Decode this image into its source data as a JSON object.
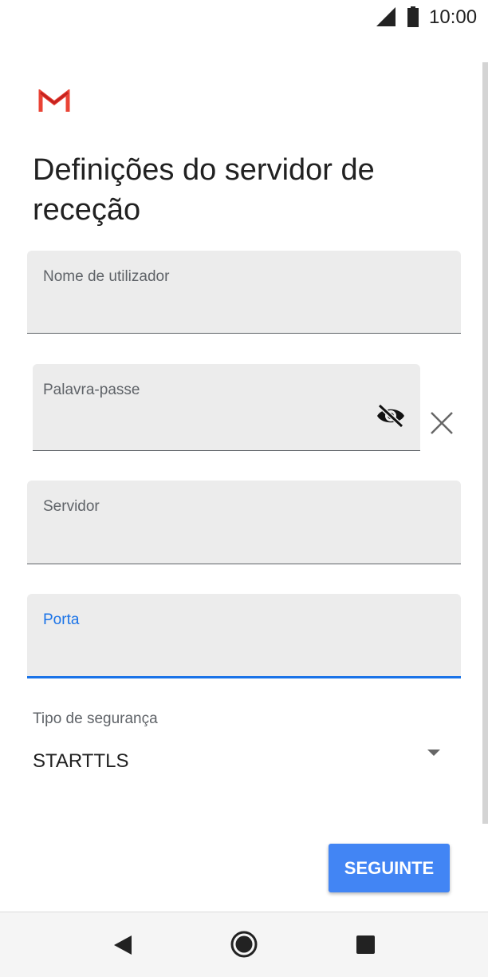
{
  "status_bar": {
    "time": "10:00",
    "signal_icon": "signal-icon",
    "battery_icon": "battery-icon"
  },
  "app": {
    "logo_icon": "gmail-logo-icon",
    "title": "Definições do servidor de receção"
  },
  "form": {
    "username": {
      "label": "Nome de utilizador",
      "value": ""
    },
    "password": {
      "label": "Palavra-passe",
      "value": "",
      "toggle_icon": "visibility-off-icon",
      "clear_icon": "close-icon"
    },
    "server": {
      "label": "Servidor",
      "value": ""
    },
    "port": {
      "label": "Porta",
      "value": "",
      "focused": true
    },
    "security": {
      "label": "Tipo de segurança",
      "value": "STARTTLS",
      "dropdown_icon": "dropdown-arrow-icon"
    }
  },
  "actions": {
    "next_label": "SEGUINTE"
  },
  "navigation": {
    "back_icon": "back-icon",
    "home_icon": "home-icon",
    "recents_icon": "recents-icon"
  },
  "colors": {
    "accent": "#1a73e8",
    "button": "#4285f4",
    "field_background": "#ececec",
    "gmail_red": "#ea4335"
  }
}
